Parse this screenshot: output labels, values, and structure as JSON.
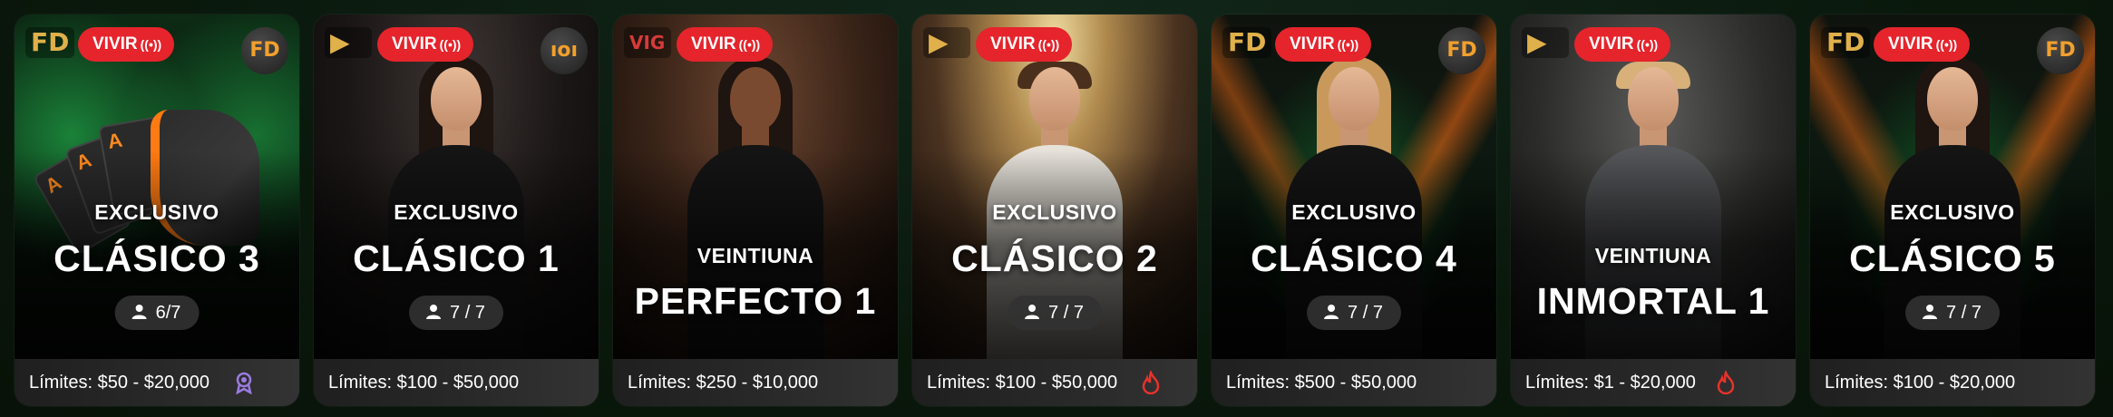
{
  "cards": [
    {
      "provider_logo": "FD",
      "live_label": "VIVIR",
      "corner_logo": "FD",
      "subtitle": "EXCLUSIVO",
      "title": "CLÁSICO 3",
      "seats": "6/7",
      "limits": "Límites: $50 - $20,000",
      "badge_icon": "award-icon"
    },
    {
      "provider_logo": "▶",
      "live_label": "VIVIR",
      "corner_logo": "ıoı",
      "subtitle": "EXCLUSIVO",
      "title": "CLÁSICO 1",
      "seats": "7 / 7",
      "limits": "Límites: $100 - $50,000"
    },
    {
      "provider_logo": "VIG",
      "live_label": "VIVIR",
      "subtitle": "VEINTIUNA",
      "title": "PERFECTO 1",
      "limits": "Límites: $250 - $10,000"
    },
    {
      "provider_logo": "▶",
      "live_label": "VIVIR",
      "subtitle": "EXCLUSIVO",
      "title": "CLÁSICO 2",
      "seats": "7 / 7",
      "limits": "Límites: $100 - $50,000",
      "badge_icon": "fire-icon"
    },
    {
      "provider_logo": "FD",
      "live_label": "VIVIR",
      "corner_logo": "FD",
      "subtitle": "EXCLUSIVO",
      "title": "CLÁSICO 4",
      "seats": "7 / 7",
      "limits": "Límites: $500 - $50,000"
    },
    {
      "provider_logo": "▶",
      "live_label": "VIVIR",
      "subtitle": "VEINTIUNA",
      "title": "INMORTAL 1",
      "limits": "Límites: $1 - $20,000",
      "badge_icon": "fire-icon"
    },
    {
      "provider_logo": "FD",
      "live_label": "VIVIR",
      "corner_logo": "FD",
      "subtitle": "EXCLUSIVO",
      "title": "CLÁSICO 5",
      "seats": "7 / 7",
      "limits": "Límites: $100 - $20,000"
    }
  ],
  "colors": {
    "live_badge": "#e5242c",
    "fire_icon": "#e8322c",
    "award_icon": "#9b7be0",
    "provider_gold": "#e0b04a"
  }
}
